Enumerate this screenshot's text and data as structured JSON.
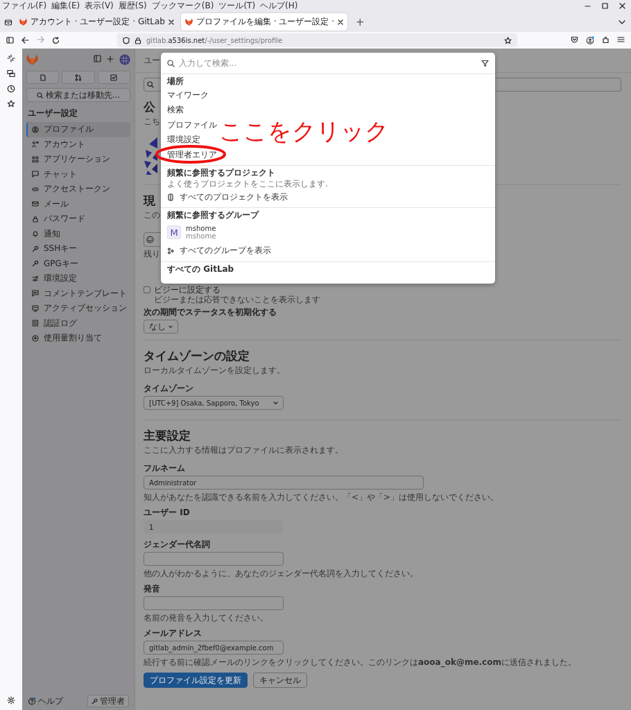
{
  "browser": {
    "menu": [
      "ファイル(F)",
      "編集(E)",
      "表示(V)",
      "履歴(S)",
      "ブックマーク(B)",
      "ツール(T)",
      "ヘルプ(H)"
    ],
    "tabs": [
      {
        "title": "アカウント · ユーザー設定 · GitLab",
        "selected": false
      },
      {
        "title": "プロファイルを編集 · ユーザー設定 ·",
        "selected": true
      }
    ],
    "new_tab": "+",
    "url": {
      "prefix": "gitlab.",
      "domain": "a536is.net",
      "path": "/-/user_settings/profile"
    }
  },
  "sidebar": {
    "search": "検索または移動先...",
    "title": "ユーザー設定",
    "items": [
      {
        "label": "プロファイル",
        "selected": true
      },
      {
        "label": "アカウント",
        "selected": false
      },
      {
        "label": "アプリケーション",
        "selected": false
      },
      {
        "label": "チャット",
        "selected": false
      },
      {
        "label": "アクセストークン",
        "selected": false
      },
      {
        "label": "メール",
        "selected": false
      },
      {
        "label": "パスワード",
        "selected": false
      },
      {
        "label": "通知",
        "selected": false
      },
      {
        "label": "SSHキー",
        "selected": false
      },
      {
        "label": "GPGキー",
        "selected": false
      },
      {
        "label": "環境設定",
        "selected": false
      },
      {
        "label": "コメントテンプレート",
        "selected": false
      },
      {
        "label": "アクティブセッション",
        "selected": false
      },
      {
        "label": "認証ログ",
        "selected": false
      },
      {
        "label": "使用量割り当て",
        "selected": false
      }
    ],
    "help": "ヘルプ",
    "admin": "管理者"
  },
  "main": {
    "breadcrumb": "ユー",
    "blocks": [
      {
        "kind": "heading",
        "text": "公"
      },
      {
        "kind": "text",
        "text": "こち"
      },
      {
        "kind": "avatar"
      },
      {
        "kind": "divider"
      },
      {
        "kind": "heading",
        "text": "現"
      },
      {
        "kind": "text",
        "text": "この"
      },
      {
        "kind": "emoji_field"
      },
      {
        "kind": "text",
        "text": "残り"
      },
      {
        "kind": "checkbox",
        "label": "ビジーに設定する",
        "checked": false
      },
      {
        "kind": "help",
        "text": "ビジーまたは応答できないことを表示します"
      },
      {
        "kind": "label",
        "text": "次の期間でステータスを初期化する"
      },
      {
        "kind": "dropdown",
        "value": "なし"
      },
      {
        "kind": "divider"
      },
      {
        "kind": "heading",
        "text": "タイムゾーンの設定"
      },
      {
        "kind": "text",
        "text": "ローカルタイムゾーンを設定します。"
      },
      {
        "kind": "label",
        "text": "タイムゾーン"
      },
      {
        "kind": "select",
        "value": "[UTC+9] Osaka, Sapporo, Tokyo"
      },
      {
        "kind": "divider"
      },
      {
        "kind": "heading",
        "text": "主要設定"
      },
      {
        "kind": "text",
        "text": "ここに入力する情報はプロファイルに表示されます。"
      },
      {
        "kind": "label",
        "text": "フルネーム"
      },
      {
        "kind": "wide_input",
        "value": "Administrator"
      },
      {
        "kind": "text",
        "text": "知人があなたを認識できる名前を入力してください。「<」や「>」は使用しないでください。"
      },
      {
        "kind": "label",
        "text": "ユーザー ID"
      },
      {
        "kind": "readonly",
        "value": "1"
      },
      {
        "kind": "label",
        "text": "ジェンダー代名詞"
      },
      {
        "kind": "input"
      },
      {
        "kind": "text",
        "text": "他の人がわかるように、あなたのジェンダー代名詞を入力してください。"
      },
      {
        "kind": "label",
        "text": "発音"
      },
      {
        "kind": "input"
      },
      {
        "kind": "text",
        "text": "名前の発音を入力してください。"
      },
      {
        "kind": "label",
        "text": "メールアドレス"
      },
      {
        "kind": "input",
        "value": "gitlab_admin_2fbef0@example.com"
      },
      {
        "kind": "text",
        "text": "続行する前に確認メールのリンクをクリックしてください。このリンクは**aooa_ok@me.com**に送信されました。"
      }
    ],
    "actions": [
      {
        "label": "プロファイル設定を更新",
        "kind": "primary"
      },
      {
        "label": "キャンセル",
        "kind": "secondary"
      }
    ]
  },
  "popup": {
    "placeholder": "入力して検索...",
    "sections": [
      {
        "title": "場所",
        "items": [
          {
            "kind": "plain",
            "label": "マイワーク"
          },
          {
            "kind": "plain",
            "label": "検索"
          },
          {
            "kind": "plain",
            "label": "プロファイル"
          },
          {
            "kind": "plain",
            "label": "環境設定"
          },
          {
            "kind": "plain",
            "label": "管理者エリア"
          }
        ]
      },
      {
        "title": "頻繁に参照するプロジェクト",
        "note": "よく使うプロジェクトをここに表示します.",
        "items": [
          {
            "kind": "project_link",
            "label": "すべてのプロジェクトを表示"
          }
        ]
      },
      {
        "title": "頻繁に参照するグループ",
        "items": [
          {
            "kind": "group",
            "avatar": "M",
            "name": "mshome",
            "path": "mshome"
          },
          {
            "kind": "group_link",
            "label": "すべてのグループを表示"
          }
        ]
      },
      {
        "title": "すべての GitLab"
      }
    ]
  },
  "annotation": {
    "text": "ここをクリック"
  }
}
